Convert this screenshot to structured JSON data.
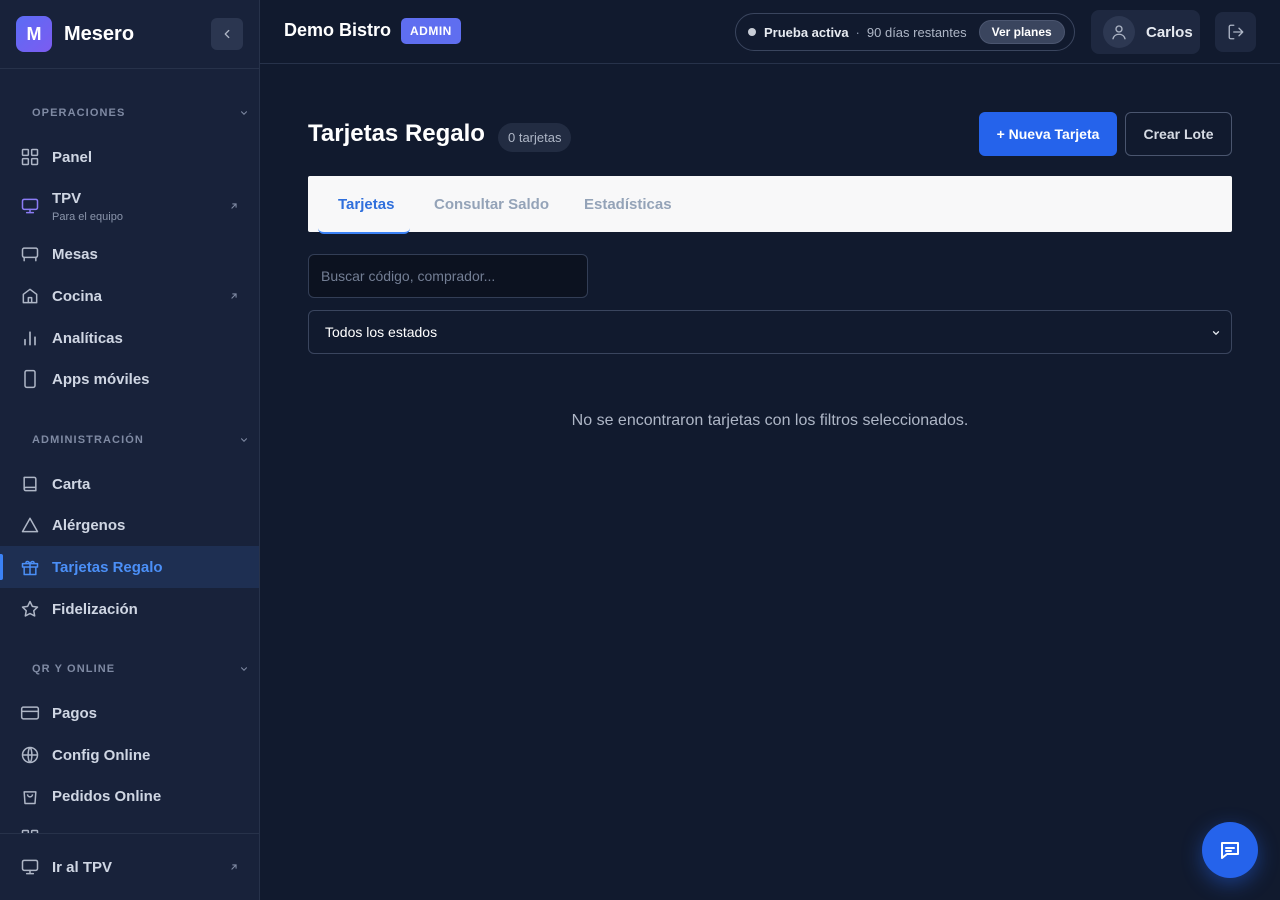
{
  "brand": {
    "logo_letter": "M",
    "name": "Mesero"
  },
  "sidebar": {
    "sections": [
      {
        "title": "OPERACIONES",
        "items": [
          {
            "label": "Panel",
            "icon": "grid-icon"
          },
          {
            "label": "TPV",
            "subtext": "Para el equipo",
            "icon": "monitor-icon",
            "external": true
          },
          {
            "label": "Mesas",
            "icon": "table-icon"
          },
          {
            "label": "Cocina",
            "icon": "home-icon",
            "external": true
          },
          {
            "label": "Analíticas",
            "icon": "bar-chart-icon"
          },
          {
            "label": "Apps móviles",
            "icon": "smartphone-icon"
          }
        ]
      },
      {
        "title": "ADMINISTRACIÓN",
        "items": [
          {
            "label": "Carta",
            "icon": "book-icon"
          },
          {
            "label": "Alérgenos",
            "icon": "warning-icon"
          },
          {
            "label": "Tarjetas Regalo",
            "icon": "gift-icon",
            "active": true
          },
          {
            "label": "Fidelización",
            "icon": "star-icon"
          }
        ]
      },
      {
        "title": "QR Y ONLINE",
        "items": [
          {
            "label": "Pagos",
            "icon": "credit-card-icon"
          },
          {
            "label": "Config Online",
            "icon": "globe-icon"
          },
          {
            "label": "Pedidos Online",
            "icon": "shopping-bag-icon"
          }
        ]
      }
    ],
    "footer": {
      "label": "Ir al TPV",
      "icon": "monitor-icon",
      "external": true
    }
  },
  "topbar": {
    "venue": "Demo Bistro",
    "role_badge": "ADMIN",
    "trial": {
      "status": "Prueba activa",
      "separator": "·",
      "days": "90 días restantes",
      "plans_button": "Ver planes"
    },
    "user": {
      "name": "Carlos"
    }
  },
  "main": {
    "title": "Tarjetas Regalo",
    "count": "0 tarjetas",
    "new_button": "+ Nueva Tarjeta",
    "batch_button": "Crear Lote",
    "tabs": [
      {
        "label": "Tarjetas",
        "active": true
      },
      {
        "label": "Consultar Saldo"
      },
      {
        "label": "Estadísticas"
      }
    ],
    "search": {
      "placeholder": "Buscar código, comprador...",
      "value": ""
    },
    "status_filter": {
      "selected": "Todos los estados"
    },
    "empty_message": "No se encontraron tarjetas con los filtros seleccionados."
  },
  "colors": {
    "accent": "#2563eb",
    "brand": "#5f6ef0",
    "background": "#111a2e",
    "sidebar": "#18223a"
  }
}
